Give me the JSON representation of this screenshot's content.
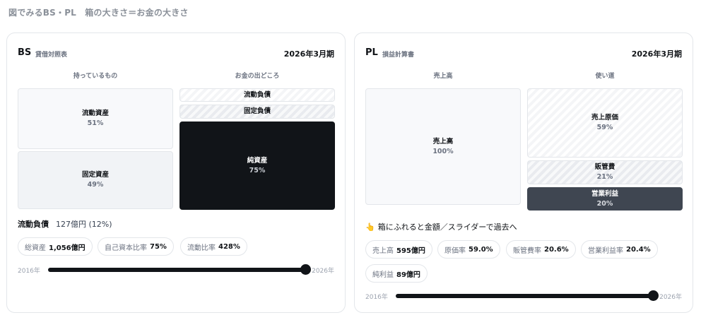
{
  "page": {
    "title": "図でみるBS・PL　箱の大きさ＝お金の大きさ"
  },
  "bs": {
    "code": "BS",
    "subtitle": "貸借対照表",
    "period": "2026年3月期",
    "left_head": "持っているもの",
    "right_head": "お金の出どころ",
    "current_assets": {
      "label": "流動資産",
      "pct": "51%"
    },
    "fixed_assets": {
      "label": "固定資産",
      "pct": "49%"
    },
    "current_liabilities": {
      "label": "流動負債"
    },
    "fixed_liabilities": {
      "label": "固定負債"
    },
    "net_assets": {
      "label": "純資産",
      "pct": "75%"
    },
    "detail": {
      "label": "流動負債",
      "value": "127億円 (12%)"
    },
    "metrics": [
      {
        "label": "総資産",
        "value": "1,056億円"
      },
      {
        "label": "自己資本比率",
        "value": "75%"
      },
      {
        "label": "流動比率",
        "value": "428%"
      }
    ],
    "slider": {
      "start": "2016年",
      "end": "2026年",
      "level": 1.0
    }
  },
  "pl": {
    "code": "PL",
    "subtitle": "損益計算書",
    "period": "2026年3月期",
    "left_head": "売上高",
    "right_head": "使い道",
    "sales": {
      "label": "売上高",
      "pct": "100%"
    },
    "cogs": {
      "label": "売上原価",
      "pct": "59%"
    },
    "sga": {
      "label": "販管費",
      "pct": "21%"
    },
    "op_profit": {
      "label": "営業利益",
      "pct": "20%"
    },
    "hint": "箱にふれると金額／スライダーで過去へ",
    "hint_icon": "pointing-hand-icon",
    "metrics": [
      {
        "label": "売上高",
        "value": "595億円"
      },
      {
        "label": "原価率",
        "value": "59.0%"
      },
      {
        "label": "販管費率",
        "value": "20.6%"
      },
      {
        "label": "営業利益率",
        "value": "20.4%"
      },
      {
        "label": "純利益",
        "value": "89億円"
      }
    ],
    "slider": {
      "start": "2016年",
      "end": "2026年",
      "level": 1.0
    }
  },
  "colors": {
    "dark": "#111418",
    "slate": "#3f4651",
    "muted": "#6b7280",
    "border": "#e3e6ea"
  }
}
